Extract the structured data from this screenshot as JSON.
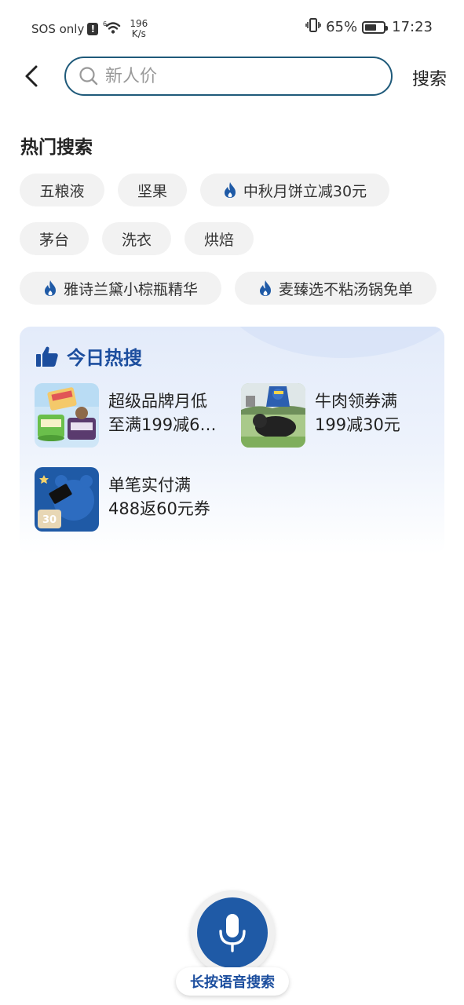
{
  "status_bar": {
    "carrier": "SOS only",
    "alert": "!",
    "net_badge": "6",
    "speed_value": "196",
    "speed_unit": "K/s",
    "battery_pct": "65%",
    "battery_level": 0.65,
    "time": "17:23"
  },
  "header": {
    "search_placeholder": "新人价",
    "search_button": "搜索"
  },
  "hot_search": {
    "title": "热门搜索",
    "chips": [
      {
        "label": "五粮液",
        "hot": false
      },
      {
        "label": "坚果",
        "hot": false
      },
      {
        "label": "中秋月饼立减30元",
        "hot": true
      },
      {
        "label": "茅台",
        "hot": false
      },
      {
        "label": "洗衣",
        "hot": false
      },
      {
        "label": "烘焙",
        "hot": false
      },
      {
        "label": "雅诗兰黛小棕瓶精华",
        "hot": true
      },
      {
        "label": "麦臻选不粘汤锅免单",
        "hot": true
      }
    ]
  },
  "today_hot": {
    "title": "今日热搜",
    "items": [
      {
        "line1": "超级品牌月低",
        "line2": "至满199减6…"
      },
      {
        "line1": "牛肉领券满",
        "line2": "199减30元"
      },
      {
        "line1": "单笔实付满",
        "line2": "488返60元券",
        "badge": "30"
      }
    ]
  },
  "voice": {
    "label": "长按语音搜索"
  },
  "colors": {
    "accent": "#1c4e9e",
    "search_border": "#1f5a7a",
    "flame": "#1f5aa6",
    "chip_bg": "#f2f2f2"
  }
}
